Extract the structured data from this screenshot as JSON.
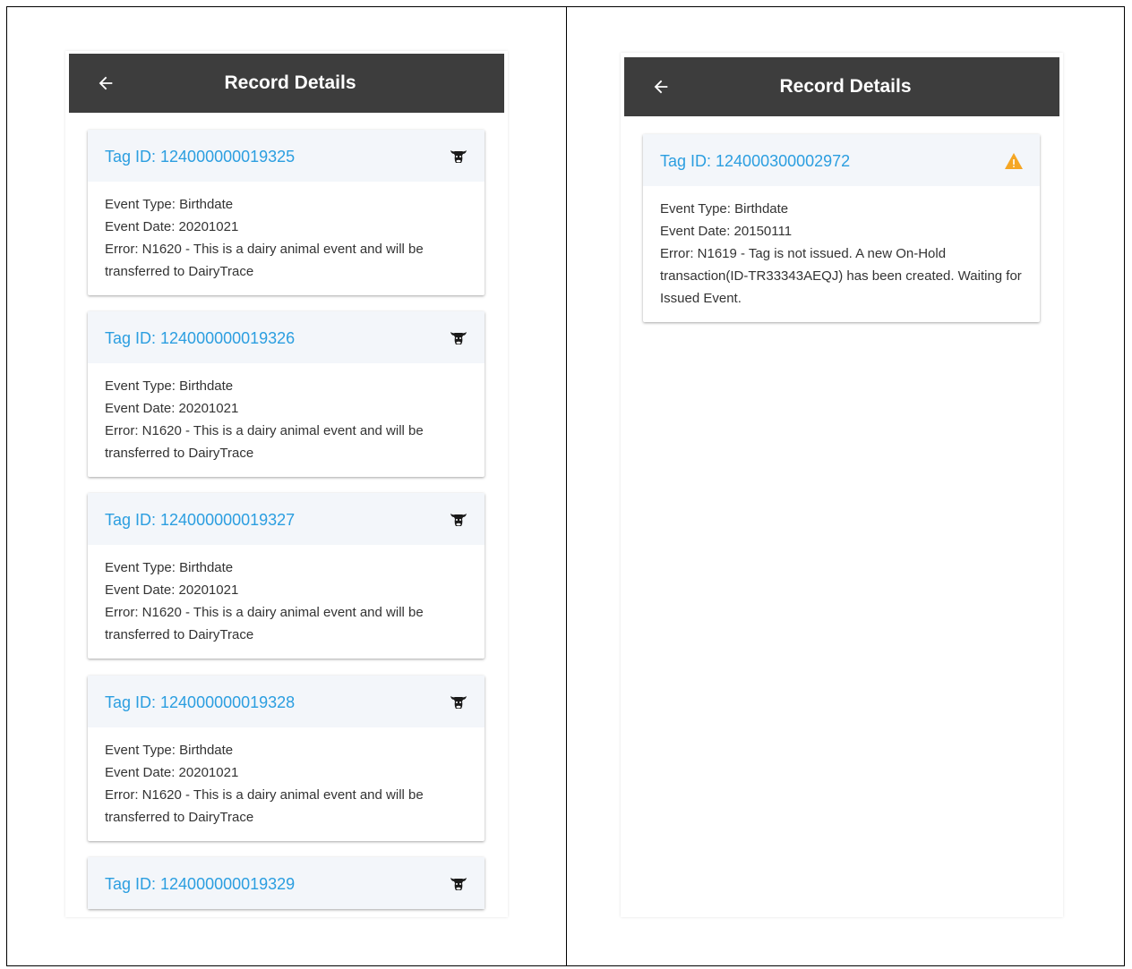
{
  "left_screen": {
    "title": "Record Details",
    "records": [
      {
        "tag": "Tag ID: 124000000019325",
        "event_type": "Event Type: Birthdate",
        "event_date": "Event Date: 20201021",
        "error": "Error: N1620 - This is a dairy animal event and will be transferred to DairyTrace",
        "icon": "cow-icon"
      },
      {
        "tag": "Tag ID: 124000000019326",
        "event_type": "Event Type: Birthdate",
        "event_date": "Event Date: 20201021",
        "error": "Error: N1620 - This is a dairy animal event and will be transferred to DairyTrace",
        "icon": "cow-icon"
      },
      {
        "tag": "Tag ID: 124000000019327",
        "event_type": "Event Type: Birthdate",
        "event_date": "Event Date: 20201021",
        "error": "Error: N1620 - This is a dairy animal event and will be transferred to DairyTrace",
        "icon": "cow-icon"
      },
      {
        "tag": "Tag ID: 124000000019328",
        "event_type": "Event Type: Birthdate",
        "event_date": "Event Date: 20201021",
        "error": "Error: N1620 - This is a dairy animal event and will be transferred to DairyTrace",
        "icon": "cow-icon"
      },
      {
        "tag": "Tag ID: 124000000019329",
        "icon": "cow-icon"
      }
    ]
  },
  "right_screen": {
    "title": "Record Details",
    "records": [
      {
        "tag": "Tag ID: 124000300002972",
        "event_type": "Event Type: Birthdate",
        "event_date": "Event Date: 20150111",
        "error": "Error: N1619 - Tag is not issued. A new On-Hold transaction(ID-TR33343AEQJ) has been created. Waiting for Issued Event.",
        "icon": "warning-icon"
      }
    ]
  },
  "colors": {
    "appbar": "#3d3d3d",
    "tag_link": "#2b9ee0",
    "card_header": "#f3f6fa",
    "warning": "#f5a623"
  }
}
